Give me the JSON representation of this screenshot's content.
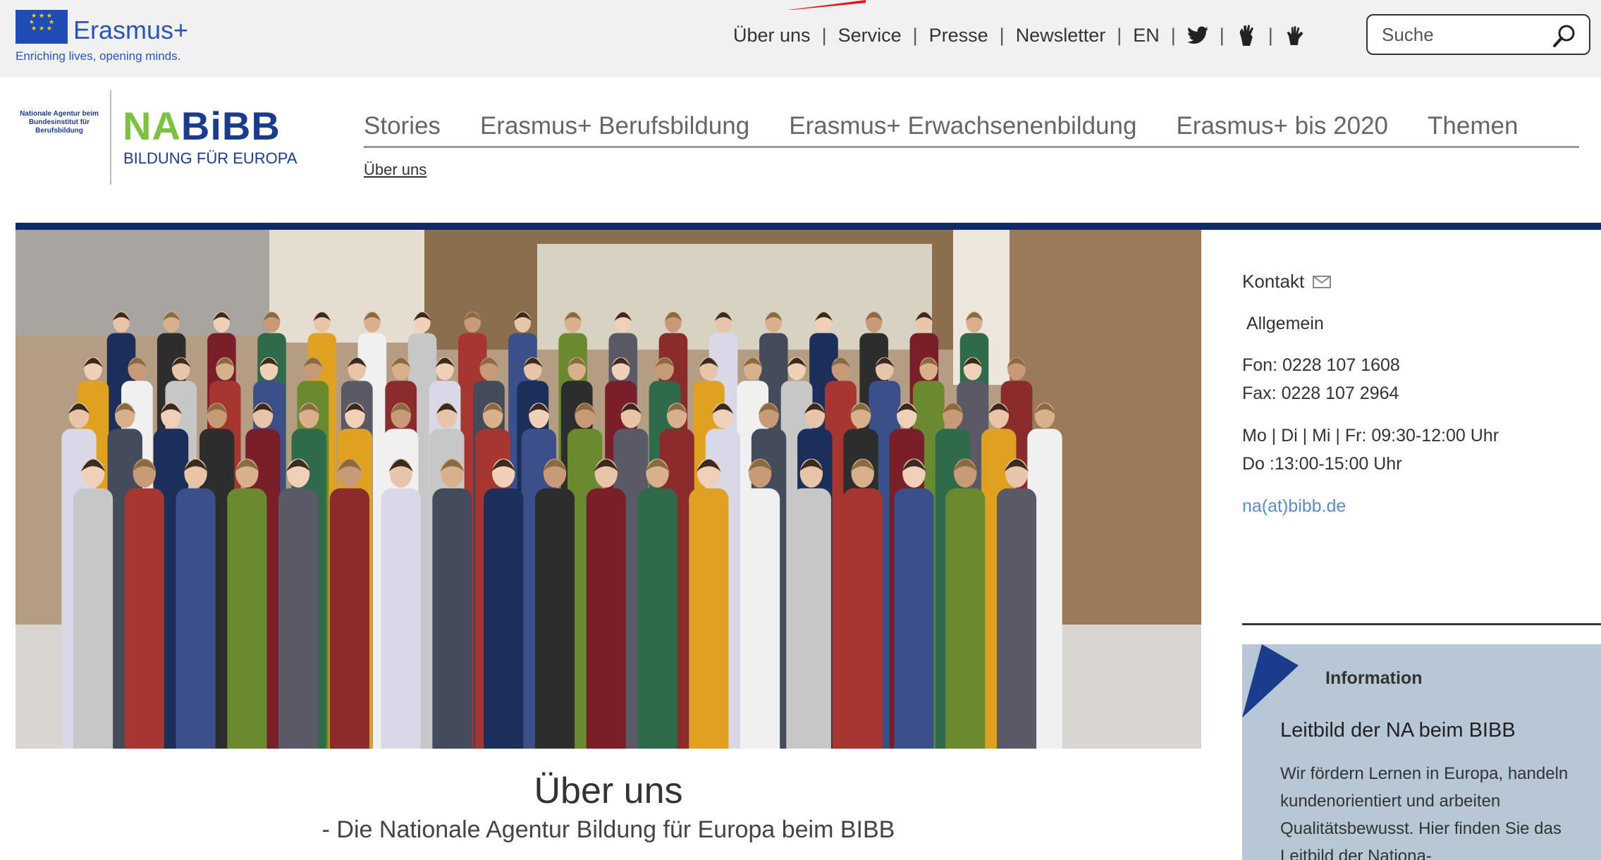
{
  "header": {
    "eu_logo": {
      "word": "Erasmus+",
      "tagline": "Enriching lives, opening minds."
    },
    "utility_nav": [
      {
        "label": "Über uns"
      },
      {
        "label": "Service"
      },
      {
        "label": "Presse"
      },
      {
        "label": "Newsletter"
      },
      {
        "label": "EN"
      }
    ],
    "social_icons": [
      "twitter-icon",
      "sign-language-icon",
      "easy-language-icon"
    ],
    "search": {
      "placeholder": "Suche",
      "icon": "search-icon"
    }
  },
  "branding": {
    "agency_small_text": "Nationale Agentur beim Bundesinstitut für Berufsbildung",
    "logo_na": "NA",
    "logo_bibb": "BiBB",
    "logo_subtitle": "BILDUNG FÜR EUROPA"
  },
  "main_nav": {
    "items": [
      {
        "label": "Stories"
      },
      {
        "label": "Erasmus+ Berufsbildung"
      },
      {
        "label": "Erasmus+ Erwachsenenbildung"
      },
      {
        "label": "Erasmus+ bis 2020"
      },
      {
        "label": "Themen"
      }
    ],
    "breadcrumb": "Über uns"
  },
  "hero": {
    "image": "group-photo"
  },
  "page": {
    "title": "Über uns",
    "subtitle": "- Die Nationale Agentur Bildung für Europa beim BIBB"
  },
  "contact": {
    "heading": "Kontakt",
    "label": "Allgemein",
    "phone": "Fon: 0228 107 1608",
    "fax": "Fax: 0228 107  2964",
    "hours_1": "Mo | Di | Mi | Fr: 09:30-12:00 Uhr",
    "hours_2": "Do :13:00-15:00 Uhr",
    "email": "na(at)bibb.de"
  },
  "info_box": {
    "label": "Information",
    "title": "Leitbild der NA beim BIBB",
    "text": "Wir fördern Lernen in Europa, handeln kundenorientiert und arbeiten Qualitätsbewusst. Hier finden Sie das Leitbild der Nationa-"
  },
  "colors": {
    "brand_blue": "#0f2a66",
    "logo_green": "#7bc241",
    "logo_blue": "#1b3c8c",
    "info_box_bg": "#b7c7d6",
    "link_blue": "#5b8dc9"
  }
}
